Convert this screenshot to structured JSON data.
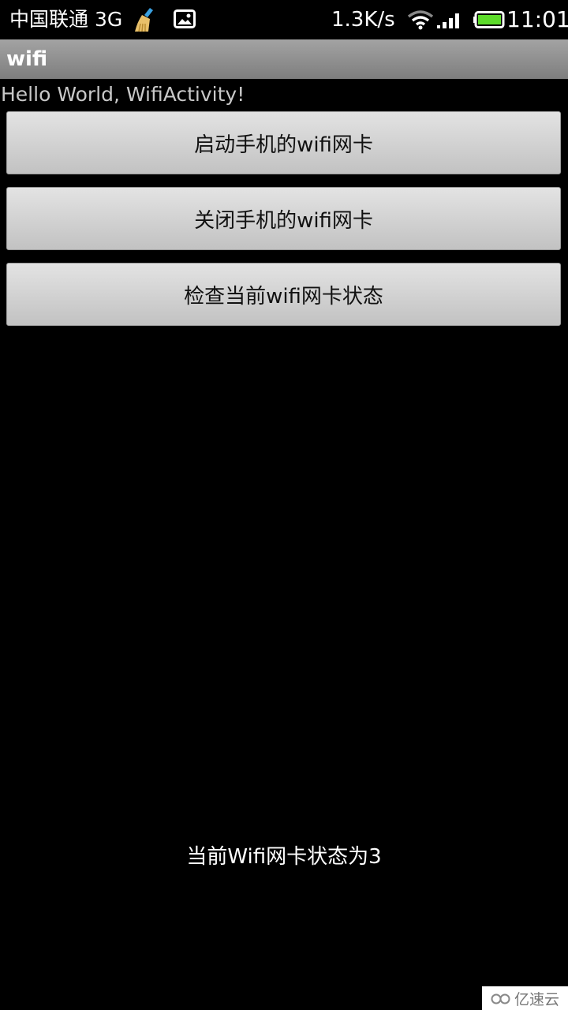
{
  "status_bar": {
    "carrier": "中国联通 3G",
    "icons": [
      "broom-cleaner-icon",
      "gallery-image-icon",
      "wifi-icon",
      "signal-bars-icon",
      "battery-icon"
    ],
    "net_speed": "1.3K/s",
    "time": "11:01",
    "battery_color": "#5ddc2b"
  },
  "action_bar": {
    "title": "wifi"
  },
  "main": {
    "greeting": "Hello World, WifiActivity!",
    "buttons": [
      {
        "label": "启动手机的wifi网卡"
      },
      {
        "label": "关闭手机的wifi网卡"
      },
      {
        "label": "检查当前wifi网卡状态"
      }
    ],
    "result_text": "当前Wifi网卡状态为3"
  },
  "watermark": {
    "text": "亿速云"
  }
}
